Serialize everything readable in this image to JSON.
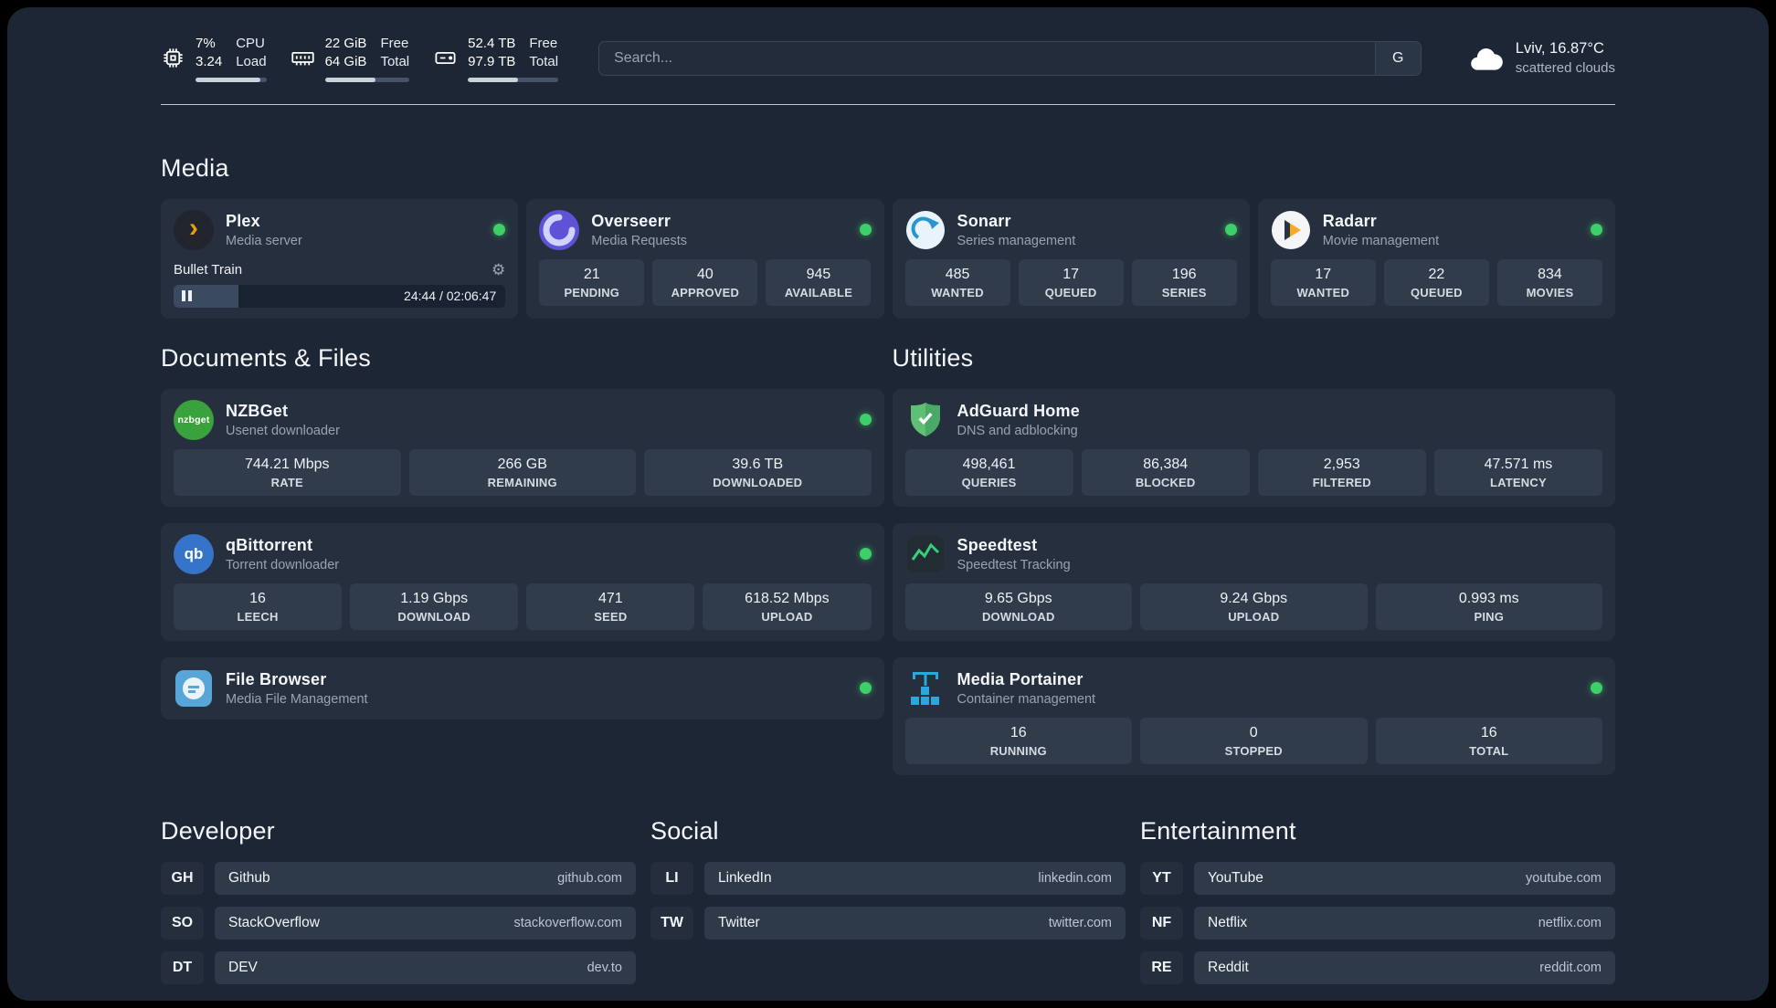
{
  "icons": {
    "gear": "⚙"
  },
  "topbar": {
    "cpu": {
      "value_top": "7%",
      "value_bottom": "3.24",
      "label_top": "CPU",
      "label_bottom": "Load",
      "bar_percent": 92
    },
    "ram": {
      "value_top": "22 GiB",
      "value_bottom": "64 GiB",
      "label_top": "Free",
      "label_bottom": "Total",
      "bar_percent": 60
    },
    "disk": {
      "value_top": "52.4 TB",
      "value_bottom": "97.9 TB",
      "label_top": "Free",
      "label_bottom": "Total",
      "bar_percent": 55
    },
    "search": {
      "placeholder": "Search...",
      "engine_button": "G"
    },
    "weather": {
      "location": "Lviv, 16.87°C",
      "condition": "scattered clouds"
    }
  },
  "media": {
    "title": "Media",
    "plex": {
      "name": "Plex",
      "desc": "Media server",
      "icon_text": "›",
      "player": {
        "track": "Bullet Train",
        "time": "24:44 / 02:06:47",
        "progress_percent": 19.5
      }
    },
    "overseerr": {
      "name": "Overseerr",
      "desc": "Media Requests",
      "stats": [
        {
          "value": "21",
          "label": "PENDING"
        },
        {
          "value": "40",
          "label": "APPROVED"
        },
        {
          "value": "945",
          "label": "AVAILABLE"
        }
      ]
    },
    "sonarr": {
      "name": "Sonarr",
      "desc": "Series management",
      "stats": [
        {
          "value": "485",
          "label": "WANTED"
        },
        {
          "value": "17",
          "label": "QUEUED"
        },
        {
          "value": "196",
          "label": "SERIES"
        }
      ]
    },
    "radarr": {
      "name": "Radarr",
      "desc": "Movie management",
      "stats": [
        {
          "value": "17",
          "label": "WANTED"
        },
        {
          "value": "22",
          "label": "QUEUED"
        },
        {
          "value": "834",
          "label": "MOVIES"
        }
      ]
    }
  },
  "documents": {
    "title": "Documents & Files",
    "nzbget": {
      "name": "NZBGet",
      "desc": "Usenet downloader",
      "icon_text": "nzbget",
      "stats": [
        {
          "value": "744.21 Mbps",
          "label": "RATE"
        },
        {
          "value": "266 GB",
          "label": "REMAINING"
        },
        {
          "value": "39.6 TB",
          "label": "DOWNLOADED"
        }
      ]
    },
    "qbittorrent": {
      "name": "qBittorrent",
      "desc": "Torrent downloader",
      "icon_text": "qb",
      "stats": [
        {
          "value": "16",
          "label": "LEECH"
        },
        {
          "value": "1.19 Gbps",
          "label": "DOWNLOAD"
        },
        {
          "value": "471",
          "label": "SEED"
        },
        {
          "value": "618.52 Mbps",
          "label": "UPLOAD"
        }
      ]
    },
    "filebrowser": {
      "name": "File Browser",
      "desc": "Media File Management"
    }
  },
  "utilities": {
    "title": "Utilities",
    "adguard": {
      "name": "AdGuard Home",
      "desc": "DNS and adblocking",
      "stats": [
        {
          "value": "498,461",
          "label": "QUERIES"
        },
        {
          "value": "86,384",
          "label": "BLOCKED"
        },
        {
          "value": "2,953",
          "label": "FILTERED"
        },
        {
          "value": "47.571 ms",
          "label": "LATENCY"
        }
      ]
    },
    "speedtest": {
      "name": "Speedtest",
      "desc": "Speedtest Tracking",
      "stats": [
        {
          "value": "9.65 Gbps",
          "label": "DOWNLOAD"
        },
        {
          "value": "9.24 Gbps",
          "label": "UPLOAD"
        },
        {
          "value": "0.993 ms",
          "label": "PING"
        }
      ]
    },
    "portainer": {
      "name": "Media Portainer",
      "desc": "Container management",
      "stats": [
        {
          "value": "16",
          "label": "RUNNING"
        },
        {
          "value": "0",
          "label": "STOPPED"
        },
        {
          "value": "16",
          "label": "TOTAL"
        }
      ]
    }
  },
  "bookmarks": {
    "developer": {
      "title": "Developer",
      "items": [
        {
          "abbr": "GH",
          "name": "Github",
          "url": "github.com"
        },
        {
          "abbr": "SO",
          "name": "StackOverflow",
          "url": "stackoverflow.com"
        },
        {
          "abbr": "DT",
          "name": "DEV",
          "url": "dev.to"
        }
      ]
    },
    "social": {
      "title": "Social",
      "items": [
        {
          "abbr": "LI",
          "name": "LinkedIn",
          "url": "linkedin.com"
        },
        {
          "abbr": "TW",
          "name": "Twitter",
          "url": "twitter.com"
        }
      ]
    },
    "entertainment": {
      "title": "Entertainment",
      "items": [
        {
          "abbr": "YT",
          "name": "YouTube",
          "url": "youtube.com"
        },
        {
          "abbr": "NF",
          "name": "Netflix",
          "url": "netflix.com"
        },
        {
          "abbr": "RE",
          "name": "Reddit",
          "url": "reddit.com"
        }
      ]
    }
  }
}
